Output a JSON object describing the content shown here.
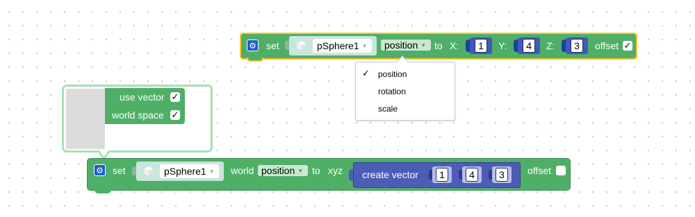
{
  "block_top": {
    "set_label": "set",
    "object_name": "pSphere1",
    "property_dropdown": "position",
    "to_label": "to",
    "x_label": "X:",
    "x_value": "1",
    "y_label": "Y:",
    "y_value": "4",
    "z_label": "Z:",
    "z_value": "3",
    "offset_label": "offset",
    "offset_checked": "✓"
  },
  "dropdown_menu": {
    "check_mark": "✓",
    "items": [
      "position",
      "rotation",
      "scale"
    ]
  },
  "mutator": {
    "use_vector_label": "use vector",
    "use_vector_checked": "✓",
    "world_space_label": "world space",
    "world_space_checked": "✓"
  },
  "block_bottom": {
    "set_label": "set",
    "object_name": "pSphere1",
    "world_label": "world",
    "property_dropdown": "position",
    "to_label": "to",
    "xyz_label": "xyz",
    "create_vector_label": "create vector",
    "vector_values": [
      "1",
      "4",
      "3"
    ],
    "offset_label": "offset",
    "offset_checked": ""
  },
  "icons": {
    "gear": "gear-icon",
    "object": "cube-icon",
    "dropdown_arrow": "chevron-down-icon",
    "check": "check-icon"
  },
  "colors": {
    "block_green": "#4faf67",
    "selection_yellow": "#fbc629",
    "vector_blue": "#4d5cb5",
    "gear_blue": "#1e5bd1"
  }
}
